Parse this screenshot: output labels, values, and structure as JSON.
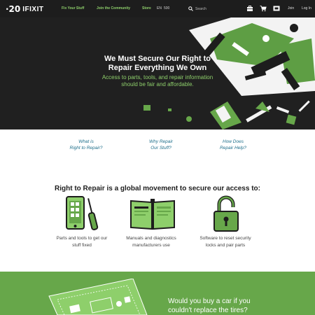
{
  "nav": {
    "logo_mark": "·20",
    "logo_text": "IFIXIT",
    "links": [
      "Fix Your Stuff",
      "Join the Community",
      "Store"
    ],
    "language": "EN",
    "language_badge": "500",
    "search_placeholder": "Search",
    "join_label": "Join",
    "login_label": "Log In"
  },
  "hero": {
    "title_line1": "We Must Secure Our Right to",
    "title_line2": "Repair Everything We Own",
    "sub_line1": "Access to parts, tools, and repair information",
    "sub_line2": "should be fair and affordable."
  },
  "questions": [
    {
      "line1": "What is",
      "line2": "Right to Repair?"
    },
    {
      "line1": "Why Repair",
      "line2": "Our Stuff?"
    },
    {
      "line1": "How Does",
      "line2": "Repair Help?"
    }
  ],
  "movement": {
    "title": "Right to Repair is a global movement to secure our access to:",
    "features": [
      {
        "line1": "Parts and tools to get our",
        "line2": "stuff fixed",
        "icon": "phone-screwdriver-icon"
      },
      {
        "line1": "Manuals and diagnostics",
        "line2": "manufacturers use",
        "icon": "manual-book-icon"
      },
      {
        "line1": "Software to reset security",
        "line2": "locks and pair parts",
        "icon": "unlocked-padlock-icon"
      }
    ]
  },
  "car": {
    "line1": "Would you buy a car if you",
    "line2": "couldn't replace the tires?"
  },
  "colors": {
    "accent_green": "#67a74a",
    "light_green": "#8ecf6b",
    "dark_bg": "#1d1d1d",
    "link_blue": "#1d6e8a"
  }
}
